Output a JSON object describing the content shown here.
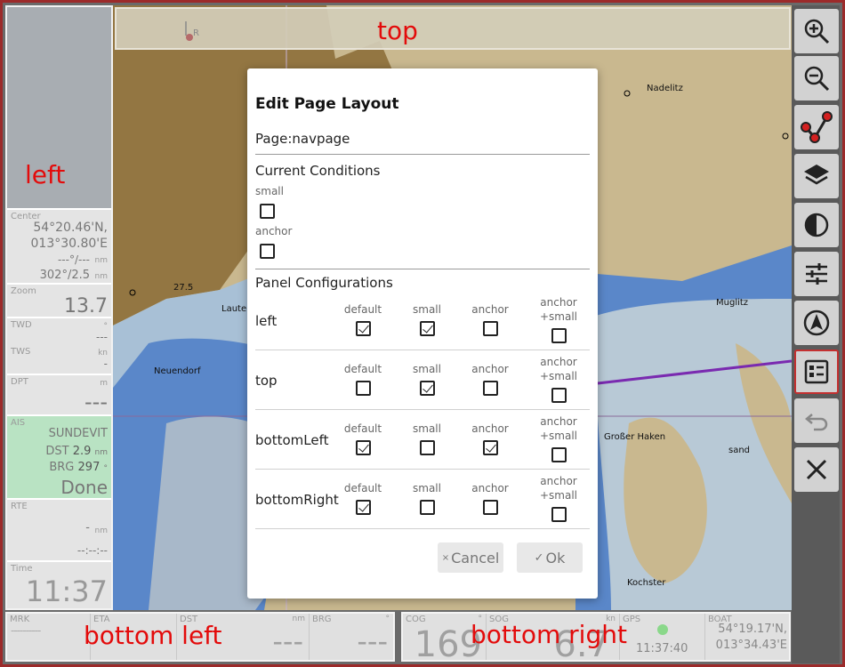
{
  "zones": {
    "top": "top",
    "left": "left",
    "bottom_left": "bottom left",
    "bottom_right": "bottom right"
  },
  "top_panel": {
    "wind_indicator": "R"
  },
  "left_panel": {
    "center": {
      "label": "Center",
      "lat": "54°20.46'N,",
      "lon": "013°30.80'E",
      "line3": "---°/---",
      "line3_unit": "nm",
      "line4": "302°/2.5",
      "line4_unit": "nm"
    },
    "zoom": {
      "label": "Zoom",
      "value": "13.7"
    },
    "twd": {
      "label": "TWD",
      "unit": "°",
      "value": "---"
    },
    "tws": {
      "label": "TWS",
      "unit": "kn",
      "value": "-"
    },
    "dpt": {
      "label": "DPT",
      "unit": "m",
      "value": "---"
    },
    "ais": {
      "label": "AIS",
      "name": "SUNDEVIT",
      "dst_label": "DST",
      "dst_value": "2.9",
      "dst_unit": "nm",
      "brg_label": "BRG",
      "brg_value": "297",
      "brg_unit": "°",
      "status": "Done"
    },
    "rte": {
      "label": "RTE",
      "value": "-",
      "unit": "nm",
      "eta": "--:--:--"
    },
    "time": {
      "label": "Time",
      "value": "11:37"
    }
  },
  "bottom_left": {
    "mrk": {
      "label": "MRK",
      "value": "----------"
    },
    "eta": {
      "label": "ETA",
      "value": ""
    },
    "dst": {
      "label": "DST",
      "unit": "nm",
      "value": "---"
    },
    "brg": {
      "label": "BRG",
      "unit": "°",
      "value": "---"
    }
  },
  "bottom_right": {
    "cog": {
      "label": "COG",
      "unit": "°",
      "value": "169"
    },
    "sog": {
      "label": "SOG",
      "unit": "kn",
      "value": "6.7"
    },
    "gps": {
      "label": "GPS",
      "time": "11:37:40"
    },
    "boat": {
      "label": "BOAT",
      "lat": "54°19.17'N,",
      "lon": "013°34.43'E"
    }
  },
  "map_labels": {
    "nadelitz": "Nadelitz",
    "lauter": "Lauter",
    "neuendorf": "Neuendorf",
    "muglitz": "Muglitz",
    "grosser_haken": "Großer Haken",
    "kochsteg": "Kochster",
    "sand": "sand",
    "depth_275": "27.5"
  },
  "dialog": {
    "title": "Edit Page Layout",
    "page": "Page:navpage",
    "current_conditions": {
      "heading": "Current Conditions",
      "options": [
        {
          "label": "small",
          "checked": false
        },
        {
          "label": "anchor",
          "checked": false
        }
      ]
    },
    "panel_configurations": {
      "heading": "Panel Configurations",
      "columns": [
        "default",
        "small",
        "anchor",
        "anchor\n+small"
      ],
      "column_line1": [
        "default",
        "small",
        "anchor",
        "anchor"
      ],
      "column_line2": [
        "",
        "",
        "",
        "+small"
      ],
      "rows": [
        {
          "name": "left",
          "checked": [
            true,
            true,
            false,
            false
          ]
        },
        {
          "name": "top",
          "checked": [
            false,
            true,
            false,
            false
          ]
        },
        {
          "name": "bottomLeft",
          "checked": [
            true,
            false,
            true,
            false
          ]
        },
        {
          "name": "bottomRight",
          "checked": [
            true,
            false,
            false,
            false
          ]
        }
      ]
    },
    "cancel_label": "Cancel",
    "ok_label": "Ok"
  },
  "colors": {
    "accent_red": "#e30b0b",
    "frame": "#9c2a2a",
    "ais_bg": "#b9e3c3"
  }
}
